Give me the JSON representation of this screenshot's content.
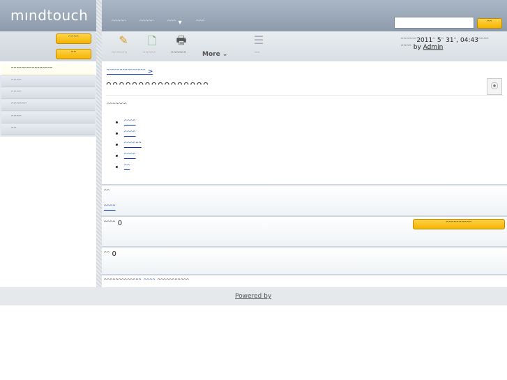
{
  "header": {
    "logo": "mındtouch",
    "nav": [
      "ᵔᵔᵔᵔᵔ",
      "ᵔᵔᵔᵔᵔ",
      "ᵔᵔᵔ ▾",
      "ᵔᵔᵔ"
    ],
    "search": {
      "value": "",
      "placeholder": "",
      "button": "ᵔᵔ"
    }
  },
  "left": {
    "login_button": "ᵔᵔᵔᵔ",
    "register_button": "ᵔᵔ",
    "current": "ᵔᵔᵔᵔᵔᵔᵔᵔᵔᵔᵔᵔᵔᵔᵔᵔ",
    "items": [
      "ᵔᵔᵔᵔ",
      "ᵔᵔᵔᵔ",
      "ᵔᵔᵔᵔᵔᵔ",
      "ᵔᵔᵔᵔ",
      "ᵔᵔ"
    ]
  },
  "toolbar": {
    "edit": "ᵔᵔᵔᵔᵔᵔ",
    "new_page": "ᵔᵔᵔᵔᵔ",
    "print": "ᵔᵔᵔᵔᵔᵔ",
    "more": "More ⌄",
    "toc": "ᵔᵔ",
    "date_line": "ᵔᵔᵔᵔᵔᵔ2011ᵔ 5ᵔ 31ᵔ, 04:43ᵔᵔᵔᵔ",
    "author_prefix": "ᵔᵔᵔᵔ by ",
    "author": "Admin"
  },
  "content": {
    "breadcrumb": "ᵔᵔᵔᵔᵔᵔᵔᵔᵔᵔᵔᵔᵔᵔᵔ >",
    "title": "ᵔᵔᵔᵔᵔᵔᵔᵔᵔᵔᵔᵔᵔᵔᵔᵔ",
    "intro": "ᵔᵔᵔᵔᵔᵔᵔ",
    "links": [
      "ᵔᵔᵔᵔ",
      "ᵔᵔᵔᵔ",
      "ᵔᵔᵔᵔᵔᵔ",
      "ᵔᵔᵔᵔ",
      "ᵔᵔ"
    ]
  },
  "sections": {
    "tags_label": "ᵔᵔ",
    "tags_link": "ᵔᵔᵔᵔ",
    "files_label": "ᵔᵔᵔᵔ 0",
    "files_button": "ᵔᵔᵔᵔᵔᵔᵔᵔᵔᵔ",
    "comments_label": "ᵔᵔ 0",
    "comment_note_pre": "ᵔᵔᵔᵔᵔᵔᵔᵔᵔᵔᵔᵔᵔ ",
    "comment_note_link": "ᵔᵔᵔᵔ",
    "comment_note_post": " ᵔᵔᵔᵔᵔᵔᵔᵔᵔᵔᵔ"
  },
  "footer": {
    "powered": "Powered by"
  }
}
